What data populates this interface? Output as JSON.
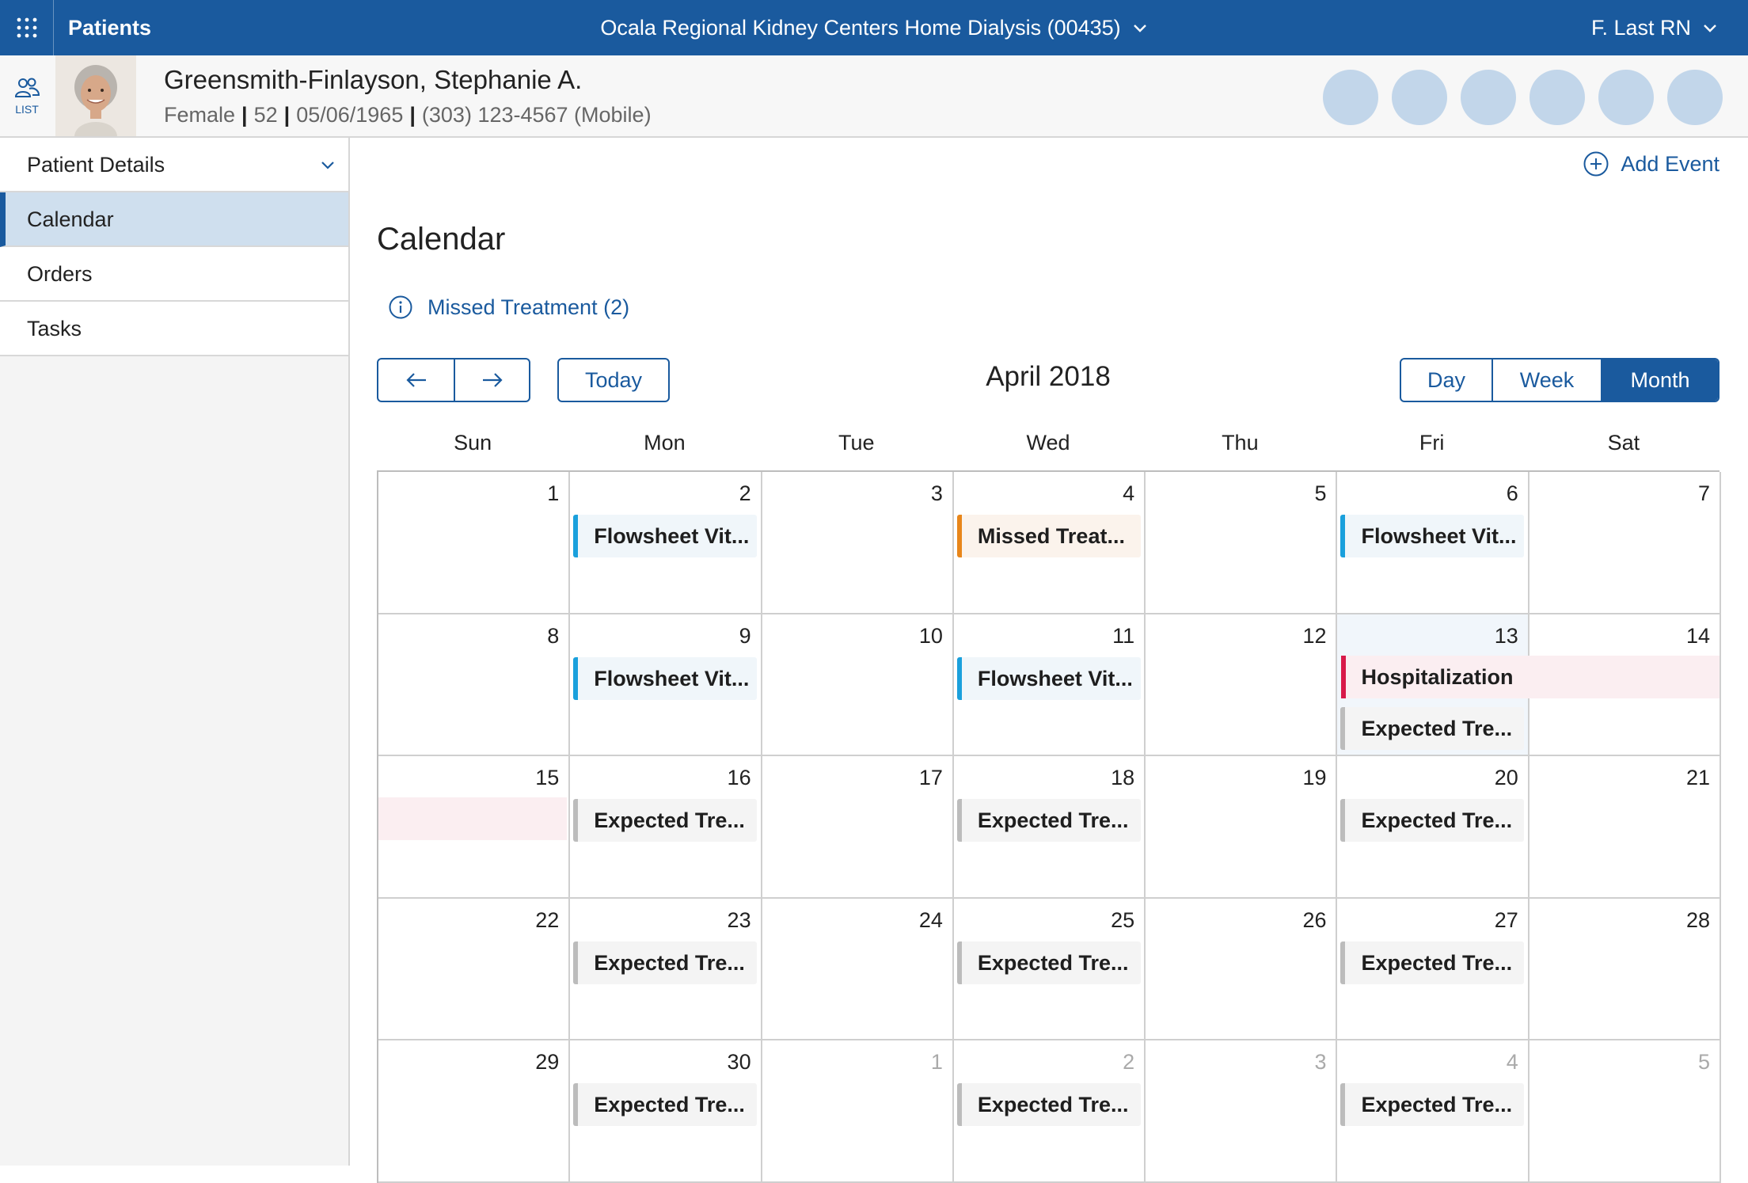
{
  "topbar": {
    "app_name": "Patients",
    "facility": "Ocala Regional Kidney Centers Home Dialysis (00435)",
    "user": "F. Last RN",
    "icons": {
      "apps": "apps-grid-icon",
      "chevron": "chevron-down-icon"
    },
    "color": "#1a5a9e"
  },
  "patient": {
    "list_label": "LIST",
    "name": "Greensmith-Finlayson, Stephanie A.",
    "gender": "Female",
    "age": "52",
    "dob": "05/06/1965",
    "phone": "(303) 123-4567 (Mobile)"
  },
  "sidebar": {
    "items": [
      {
        "label": "Patient Details",
        "expandable": true
      },
      {
        "label": "Calendar",
        "active": true
      },
      {
        "label": "Orders"
      },
      {
        "label": "Tasks"
      }
    ]
  },
  "main": {
    "add_event": "Add Event",
    "title": "Calendar",
    "missed_treatment": "Missed Treatment (2)",
    "today": "Today",
    "month_label": "April 2018",
    "views": [
      "Day",
      "Week",
      "Month"
    ],
    "active_view": "Month"
  },
  "calendar": {
    "weekdays": [
      "Sun",
      "Mon",
      "Tue",
      "Wed",
      "Thu",
      "Fri",
      "Sat"
    ],
    "event_colors": {
      "flowsheet": "#1aa0dc",
      "missed": "#e8861a",
      "expected": "#bcbcbc",
      "hospitalization": "#d81a4a"
    },
    "weeks": [
      [
        {
          "day": "1",
          "events": []
        },
        {
          "day": "2",
          "events": [
            {
              "label": "Flowsheet Vit...",
              "type": "blue"
            }
          ]
        },
        {
          "day": "3",
          "events": []
        },
        {
          "day": "4",
          "events": [
            {
              "label": "Missed Treat...",
              "type": "orange"
            }
          ]
        },
        {
          "day": "5",
          "events": []
        },
        {
          "day": "6",
          "events": [
            {
              "label": "Flowsheet Vit...",
              "type": "blue"
            }
          ]
        },
        {
          "day": "7",
          "events": []
        }
      ],
      [
        {
          "day": "8",
          "events": []
        },
        {
          "day": "9",
          "events": [
            {
              "label": "Flowsheet Vit...",
              "type": "blue"
            }
          ]
        },
        {
          "day": "10",
          "events": []
        },
        {
          "day": "11",
          "events": [
            {
              "label": "Flowsheet Vit...",
              "type": "blue"
            }
          ]
        },
        {
          "day": "12",
          "events": []
        },
        {
          "day": "13",
          "highlight": true,
          "events": [
            {
              "label": "Expected Tre...",
              "type": "grey",
              "slot": 2
            }
          ]
        },
        {
          "day": "14",
          "events": []
        }
      ],
      [
        {
          "day": "15",
          "events": []
        },
        {
          "day": "16",
          "events": [
            {
              "label": "Expected Tre...",
              "type": "grey"
            }
          ]
        },
        {
          "day": "17",
          "events": []
        },
        {
          "day": "18",
          "events": [
            {
              "label": "Expected Tre...",
              "type": "grey"
            }
          ]
        },
        {
          "day": "19",
          "events": []
        },
        {
          "day": "20",
          "events": [
            {
              "label": "Expected Tre...",
              "type": "grey"
            }
          ]
        },
        {
          "day": "21",
          "events": []
        }
      ],
      [
        {
          "day": "22",
          "events": []
        },
        {
          "day": "23",
          "events": [
            {
              "label": "Expected Tre...",
              "type": "grey"
            }
          ]
        },
        {
          "day": "24",
          "events": []
        },
        {
          "day": "25",
          "events": [
            {
              "label": "Expected Tre...",
              "type": "grey"
            }
          ]
        },
        {
          "day": "26",
          "events": []
        },
        {
          "day": "27",
          "events": [
            {
              "label": "Expected Tre...",
              "type": "grey"
            }
          ]
        },
        {
          "day": "28",
          "events": []
        }
      ],
      [
        {
          "day": "29",
          "events": []
        },
        {
          "day": "30",
          "events": [
            {
              "label": "Expected Tre...",
              "type": "grey"
            }
          ]
        },
        {
          "day": "1",
          "other": true,
          "events": []
        },
        {
          "day": "2",
          "other": true,
          "events": [
            {
              "label": "Expected Tre...",
              "type": "grey"
            }
          ]
        },
        {
          "day": "3",
          "other": true,
          "events": []
        },
        {
          "day": "4",
          "other": true,
          "events": [
            {
              "label": "Expected Tre...",
              "type": "grey"
            }
          ]
        },
        {
          "day": "5",
          "other": true,
          "events": []
        }
      ]
    ],
    "spanning_event": {
      "label": "Hospitalization"
    }
  }
}
